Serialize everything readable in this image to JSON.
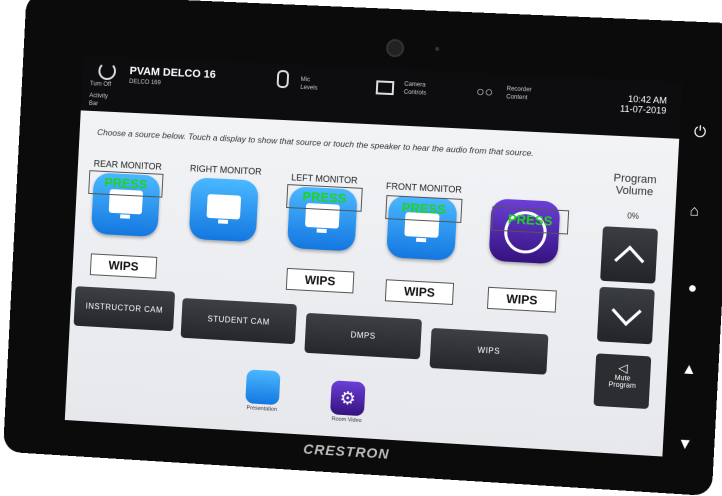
{
  "topbar": {
    "power_label": "Turn Off",
    "room_name": "PVAM DELCO 16",
    "room_sub": "DELCO 169",
    "activity_label": "Activity",
    "activity_sub": "Bar",
    "mic_label_1": "Mic",
    "mic_label_2": "Levels",
    "camera_label_1": "Camera",
    "camera_label_2": "Controls",
    "voicemail_label_1": "Recorder",
    "voicemail_label_2": "Content",
    "time": "10:42 AM",
    "date": "11-07-2019"
  },
  "instructions": "Choose a source below. Touch a display to show that source or touch the speaker to hear the audio from that source.",
  "sources": [
    {
      "label": "REAR MONITOR",
      "press": "PRESS",
      "value": "WIPS"
    },
    {
      "label": "RIGHT MONITOR",
      "press": "",
      "value": ""
    },
    {
      "label": "LEFT MONITOR",
      "press": "PRESS",
      "value": "WIPS"
    },
    {
      "label": "FRONT MONITOR",
      "press": "PRESS",
      "value": "WIPS"
    },
    {
      "label": "",
      "press": "PRESS",
      "value": "WIPS"
    }
  ],
  "buttons": [
    "INSTRUCTOR CAM",
    "STUDENT CAM",
    "DMPS",
    "WIPS"
  ],
  "volume": {
    "title_1": "Program",
    "title_2": "Volume",
    "percent": "0%",
    "mute_1": "Mute",
    "mute_2": "Program"
  },
  "dock": {
    "presentation": "Presentation",
    "video": "Room Video"
  },
  "brand": "CRESTRON"
}
